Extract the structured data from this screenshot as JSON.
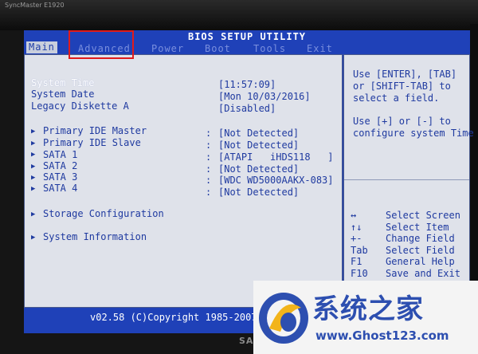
{
  "monitor": {
    "brand": "SyncMaster E1920",
    "logo": "SAMSUNG"
  },
  "bios": {
    "title": "BIOS SETUP UTILITY",
    "tabs": [
      {
        "label": "Main",
        "active": true
      },
      {
        "label": "Advanced",
        "active": false,
        "highlighted": true
      },
      {
        "label": "Power",
        "active": false
      },
      {
        "label": "Boot",
        "active": false
      },
      {
        "label": "Tools",
        "active": false
      },
      {
        "label": "Exit",
        "active": false
      }
    ],
    "settings": [
      {
        "label": "System Time",
        "value": "[11:57:09]"
      },
      {
        "label": "System Date",
        "value": "[Mon 10/03/2016]"
      },
      {
        "label": "Legacy Diskette A",
        "value": "[Disabled]"
      }
    ],
    "drives": [
      {
        "label": "Primary IDE Master",
        "value": "[Not Detected]"
      },
      {
        "label": "Primary IDE Slave",
        "value": "[Not Detected]"
      },
      {
        "label": "SATA 1",
        "value": "[ATAPI   iHDS118   ]"
      },
      {
        "label": "SATA 2",
        "value": "[Not Detected]"
      },
      {
        "label": "SATA 3",
        "value": "[WDC WD5000AAKX-083]"
      },
      {
        "label": "SATA 4",
        "value": "[Not Detected]"
      }
    ],
    "submenus": [
      {
        "label": "Storage Configuration"
      },
      {
        "label": "System Information"
      }
    ],
    "help": {
      "line1": "Use [ENTER], [TAB]",
      "line2": "or [SHIFT-TAB] to",
      "line3": "select a field.",
      "line4": "Use [+] or [-] to",
      "line5": "configure system Time"
    },
    "keys": [
      {
        "key": "↔",
        "desc": "Select Screen"
      },
      {
        "key": "↑↓",
        "desc": "Select Item"
      },
      {
        "key": "+-",
        "desc": "Change Field"
      },
      {
        "key": "Tab",
        "desc": "Select Field"
      },
      {
        "key": "F1",
        "desc": "General Help"
      },
      {
        "key": "F10",
        "desc": "Save and Exit"
      }
    ],
    "copyright": "v02.58 (C)Copyright 1985-2007"
  },
  "watermark": {
    "title": "系统之家",
    "url": "www.Ghost123.com"
  },
  "colors": {
    "screen_blue": "#1d3fb3",
    "panel_gray": "#dfe2ea",
    "text_blue": "#1f3aa0",
    "highlight_red": "#e11b1b"
  }
}
